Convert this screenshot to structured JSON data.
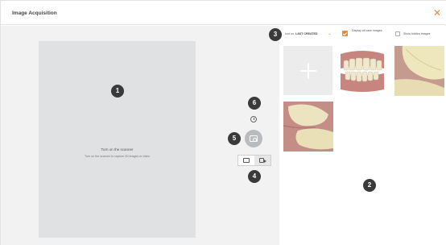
{
  "window": {
    "title": "Image Acquisition",
    "close_icon": "close-x-icon",
    "accent": "#e8893a"
  },
  "preview": {
    "title": "Turn on the scanner",
    "subtitle": "Turn on the scanner to capture 2D images or video"
  },
  "controls": {
    "timer_icon": "timer-icon",
    "capture_icon": "camera-icon",
    "mode_photo_icon": "photo-camera-icon",
    "mode_video_icon": "video-camera-icon"
  },
  "gallery": {
    "sort_label": "sort on:",
    "sort_value": "LAST CREATED",
    "display_all_label": "Display all case images",
    "display_all_checked": true,
    "show_hidden_label": "Show hidden images",
    "show_hidden_checked": false,
    "add_icon": "plus-icon",
    "thumbnails": [
      "teeth-frontal-view",
      "tooth-closeup",
      "tooth-closeup-side"
    ]
  },
  "callouts": [
    "1",
    "2",
    "3",
    "4",
    "5",
    "6"
  ]
}
